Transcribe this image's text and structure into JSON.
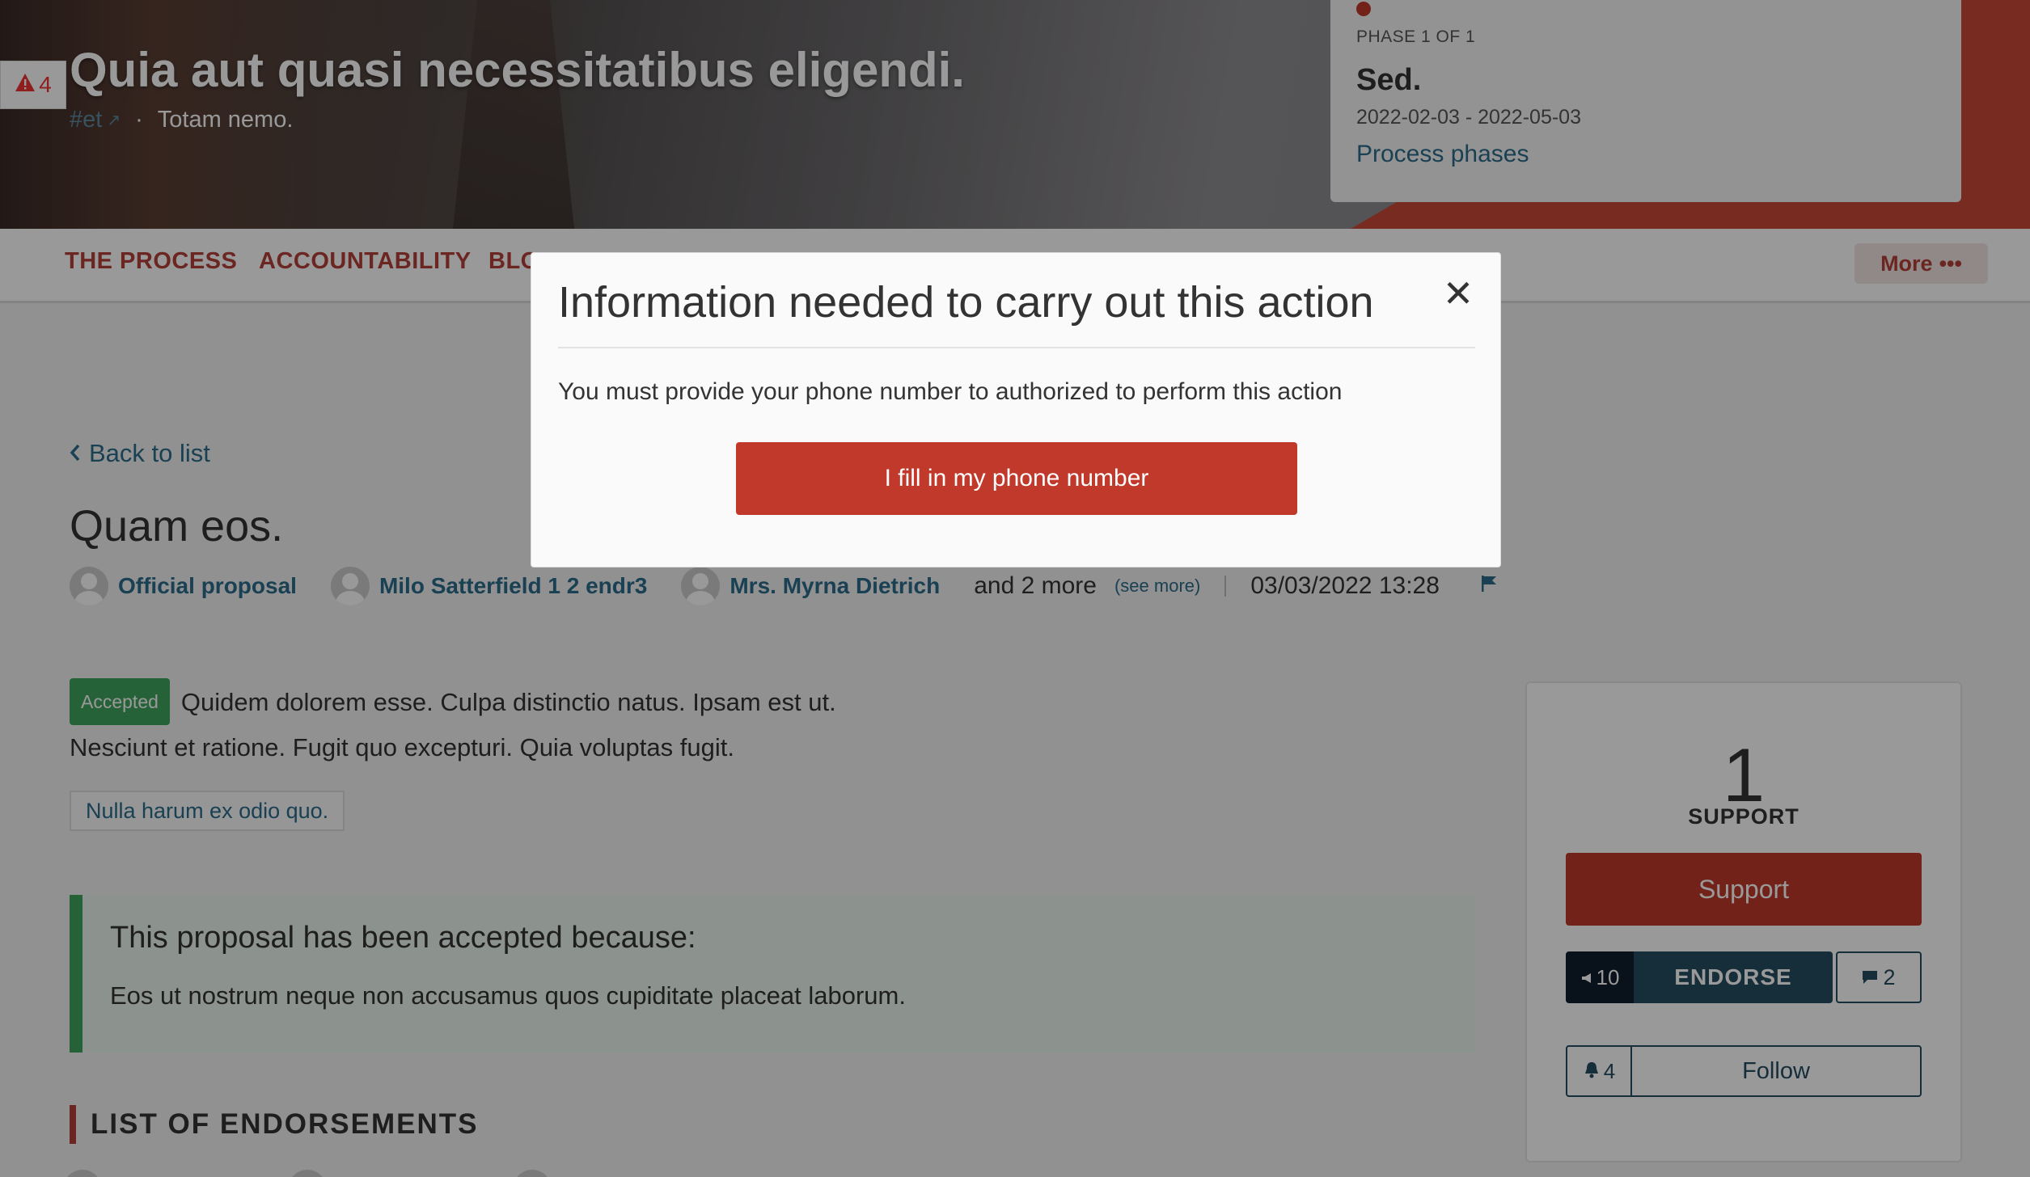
{
  "hero": {
    "alert_count": "4",
    "title": "Quia aut quasi necessitatibus eligendi.",
    "hashtag": "#et",
    "subtitle": "Totam nemo."
  },
  "phase": {
    "label": "PHASE 1 OF 1",
    "name": "Sed.",
    "dates": "2022-02-03 - 2022-05-03",
    "link": "Process phases"
  },
  "nav": {
    "items": [
      "THE PROCESS",
      "ACCOUNTABILITY",
      "BLO"
    ],
    "more_label": "More"
  },
  "proposal": {
    "back_label": "Back to list",
    "title": "Quam eos.",
    "authors": [
      "Official proposal",
      "Milo Satterfield 1 2 endr3",
      "Mrs. Myrna Dietrich"
    ],
    "and_more": "and 2 more",
    "see_more": "(see more)",
    "date": "03/03/2022 13:28",
    "status_badge": "Accepted",
    "body_line1": "Quidem dolorem esse. Culpa distinctio natus. Ipsam est ut.",
    "body_line2": "Nesciunt et ratione. Fugit quo excepturi. Quia voluptas fugit.",
    "tag": "Nulla harum ex odio quo.",
    "callout_title": "This proposal has been accepted because:",
    "callout_body": "Eos ut nostrum neque non accusamus quos cupiditate placeat laborum.",
    "endorsements_heading": "LIST OF ENDORSEMENTS"
  },
  "support": {
    "count": "1",
    "label": "SUPPORT",
    "button": "Support",
    "endorse_count": "10",
    "endorse_label": "ENDORSE",
    "comments_count": "2",
    "follow_count": "4",
    "follow_label": "Follow"
  },
  "modal": {
    "title": "Information needed to carry out this action",
    "close_glyph": "✕",
    "text": "You must provide your phone number to authorized to perform this action",
    "button": "I fill in my phone number"
  },
  "colors": {
    "primary": "#c0392b",
    "secondary": "#254b61",
    "success": "#3ea35e",
    "link": "#2a6b8a"
  },
  "icons": [
    "alert-triangle-icon",
    "external-link-icon",
    "chevron-left-icon",
    "flag-icon",
    "megaphone-icon",
    "comment-icon",
    "bell-icon",
    "close-icon",
    "more-dots-icon"
  ]
}
